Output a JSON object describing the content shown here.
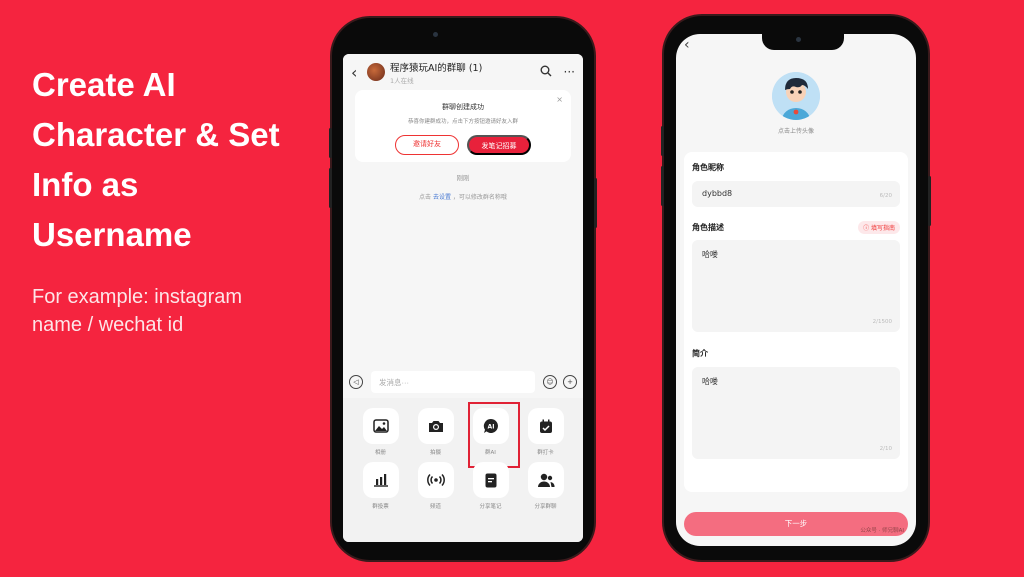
{
  "slide": {
    "headline": "Create AI Character & Set Info as Username",
    "subline": "For example: instagram name / wechat id",
    "background_color": "#f5243f"
  },
  "phone_left": {
    "header": {
      "back_icon": "chevron-left-icon",
      "group_name": "程序猿玩AI的群聊 (1)",
      "member_status": "1人在线",
      "search_icon": "search-icon",
      "more_icon": "more-horizontal-icon"
    },
    "success_card": {
      "title": "群聊创建成功",
      "description": "恭喜你建群成功，点击下方按钮邀请好友入群",
      "close_icon": "close-icon",
      "invite_label": "邀请好友",
      "post_label": "发笔记招募"
    },
    "system_messages": {
      "time": "刚刚",
      "hint_prefix": "点击",
      "hint_link": "去设置",
      "hint_suffix": "，可以修改群名称哦"
    },
    "input": {
      "placeholder": "发消息···",
      "voice_icon": "voice-icon",
      "emoji_icon": "emoji-icon",
      "plus_icon": "plus-icon"
    },
    "tools": [
      {
        "label": "相册",
        "icon": "image-icon"
      },
      {
        "label": "拍摄",
        "icon": "camera-icon"
      },
      {
        "label": "群AI",
        "icon": "ai-chat-icon",
        "highlighted": true
      },
      {
        "label": "群打卡",
        "icon": "calendar-check-icon"
      },
      {
        "label": "群投票",
        "icon": "bar-chart-icon"
      },
      {
        "label": "频道",
        "icon": "broadcast-icon"
      },
      {
        "label": "分享笔记",
        "icon": "note-icon"
      },
      {
        "label": "分享群聊",
        "icon": "group-share-icon"
      }
    ]
  },
  "phone_right": {
    "back_icon": "chevron-left-icon",
    "avatar_label": "点击上传头像",
    "fields": {
      "nickname": {
        "label": "角色昵称",
        "value": "dybbd8",
        "count": "6/20"
      },
      "description": {
        "label": "角色描述",
        "guide": "填写指南",
        "value": "哈喽",
        "count": "2/1500"
      },
      "intro": {
        "label": "简介",
        "value": "哈喽",
        "count": "2/10"
      }
    },
    "next_label": "下一步",
    "watermark": "公众号 · 师兄聊AI"
  }
}
